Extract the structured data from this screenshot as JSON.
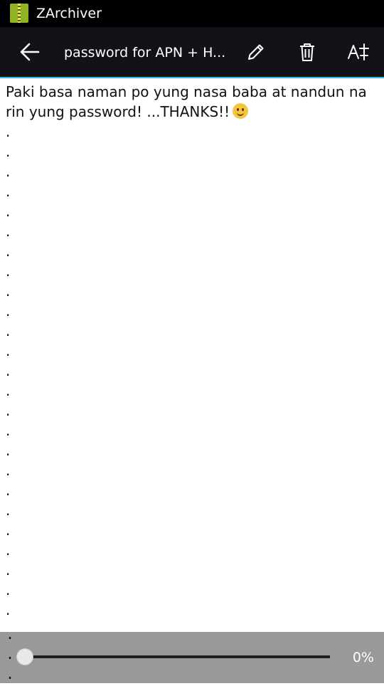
{
  "status_bar": {
    "app_name": "ZArchiver"
  },
  "toolbar": {
    "title": "password for APN + H...",
    "icons": {
      "back": "arrow-back-icon",
      "edit": "pencil-icon",
      "delete": "trash-icon",
      "font": "font-size-icon"
    }
  },
  "document": {
    "text": "Paki basa naman po yung nasa baba at nandun na rin yung password! ...THANKS!!",
    "emoji": "smiley-emoji-icon",
    "dots": ".\n.\n.\n.\n.\n.\n.\n.\n.\n.\n.\n.\n.\n.\n.\n.\n.\n.\n.\n.\n.\n.\n.\n.\n.\n.",
    "overflow_dots": ".\n.\n."
  },
  "bottom_bar": {
    "progress_percent": 0,
    "progress_label": "0%"
  },
  "colors": {
    "accent": "#33b5e5",
    "toolbar_bg": "#121317",
    "status_bar_bg": "#000000",
    "bottom_bar_bg": "#999999"
  }
}
